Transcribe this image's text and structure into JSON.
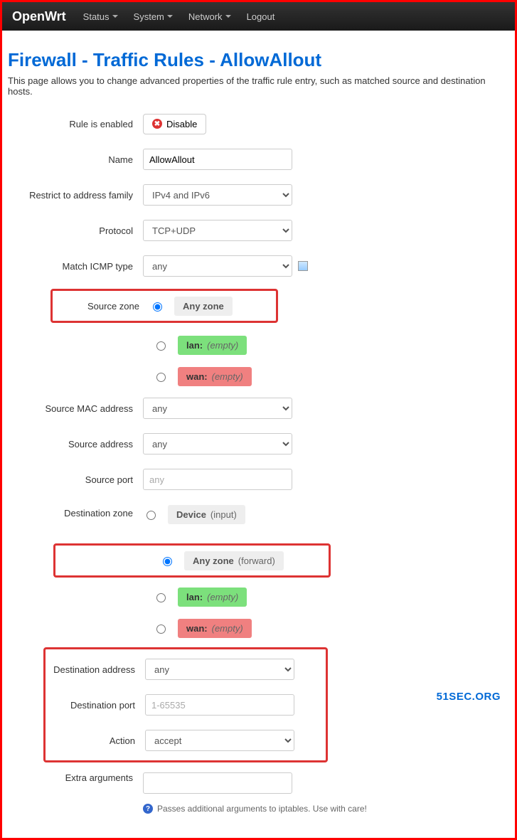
{
  "nav": {
    "brand": "OpenWrt",
    "items": [
      "Status",
      "System",
      "Network",
      "Logout"
    ]
  },
  "page": {
    "title": "Firewall - Traffic Rules - AllowAllout",
    "desc": "This page allows you to change advanced properties of the traffic rule entry, such as matched source and destination hosts."
  },
  "watermark": "51SEC.ORG",
  "form": {
    "rule_enabled_label": "Rule is enabled",
    "disable_btn": "Disable",
    "name_label": "Name",
    "name_value": "AllowAllout",
    "family_label": "Restrict to address family",
    "family_value": "IPv4 and IPv6",
    "proto_label": "Protocol",
    "proto_value": "TCP+UDP",
    "icmp_label": "Match ICMP type",
    "icmp_value": "any",
    "srczone_label": "Source zone",
    "zones": {
      "any": "Any zone",
      "device": "Device",
      "input_note": "(input)",
      "forward_note": "(forward)",
      "lan": "lan:",
      "wan": "wan:",
      "empty": "(empty)"
    },
    "srcmac_label": "Source MAC address",
    "srcmac_value": "any",
    "srcaddr_label": "Source address",
    "srcaddr_value": "any",
    "srcport_label": "Source port",
    "srcport_placeholder": "any",
    "dstzone_label": "Destination zone",
    "dstaddr_label": "Destination address",
    "dstaddr_value": "any",
    "dstport_label": "Destination port",
    "dstport_value": "1-65535",
    "action_label": "Action",
    "action_value": "accept",
    "extra_label": "Extra arguments",
    "extra_hint": "Passes additional arguments to iptables. Use with care!"
  }
}
